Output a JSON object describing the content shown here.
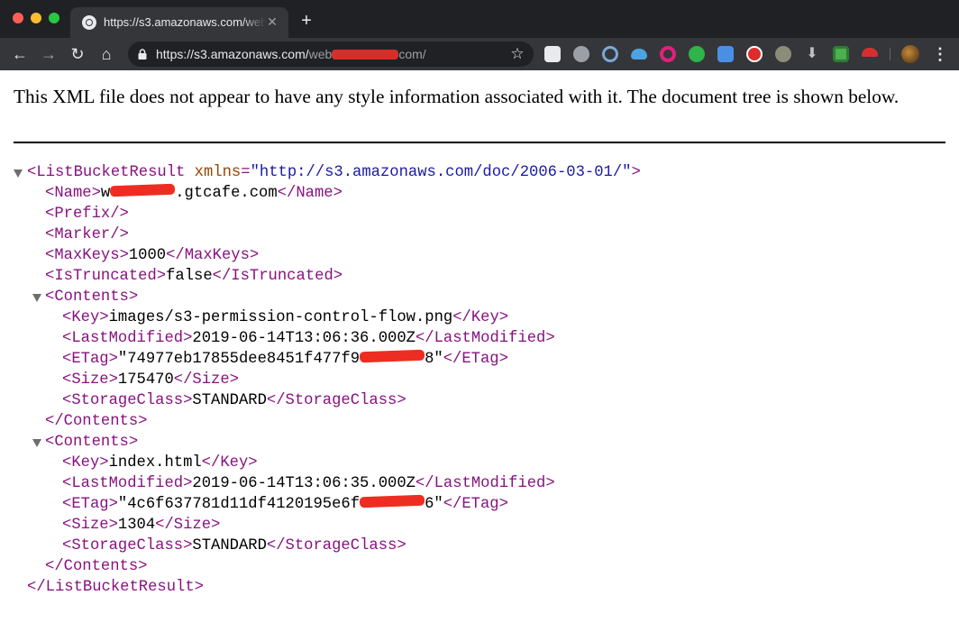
{
  "browser": {
    "tab_title": "https://s3.amazonaws.com/web",
    "tab_close": "✕",
    "new_tab": "+",
    "url_host": "https://s3.amazonaws.com/",
    "url_path_start": "web",
    "url_path_end": "com/",
    "nav_back": "←",
    "nav_forward": "→",
    "nav_reload": "↻",
    "nav_home": "⌂",
    "star": "☆",
    "menu": "⋮"
  },
  "page": {
    "notice": "This XML file does not appear to have any style information associated with it. The document tree is shown below."
  },
  "xml": {
    "root_open": "<ListBucketResult",
    "root_attr_name": "xmlns",
    "root_attr_eq": "=",
    "root_attr_value": "\"http://s3.amazonaws.com/doc/2006-03-01/\"",
    "root_open_end": ">",
    "root_close": "</ListBucketResult>",
    "name_open": "<Name>",
    "name_start": "w",
    "name_end": ".gtcafe.com",
    "name_close": "</Name>",
    "prefix": "<Prefix/>",
    "marker": "<Marker/>",
    "maxkeys_open": "<MaxKeys>",
    "maxkeys": "1000",
    "maxkeys_close": "</MaxKeys>",
    "truncated_open": "<IsTruncated>",
    "truncated": "false",
    "truncated_close": "</IsTruncated>",
    "contents_open": "<Contents>",
    "contents_close": "</Contents>",
    "key_open": "<Key>",
    "key_close": "</Key>",
    "lastmod_open": "<LastModified>",
    "lastmod_close": "</LastModified>",
    "etag_open": "<ETag>",
    "etag_close": "</ETag>",
    "size_open": "<Size>",
    "size_close": "</Size>",
    "storage_open": "<StorageClass>",
    "storage_close": "</StorageClass>",
    "contents": [
      {
        "key": "images/s3-permission-control-flow.png",
        "last_modified": "2019-06-14T13:06:36.000Z",
        "etag_start": "\"74977eb17855dee8451f477f9",
        "etag_end": "8\"",
        "size": "175470",
        "storage_class": "STANDARD"
      },
      {
        "key": "index.html",
        "last_modified": "2019-06-14T13:06:35.000Z",
        "etag_start": "\"4c6f637781d11df4120195e6f",
        "etag_end": "6\"",
        "size": "1304",
        "storage_class": "STANDARD"
      }
    ]
  },
  "colors": {
    "tag": "#881280",
    "attribute": "#994500",
    "attribute_value": "#1a1aa6",
    "redaction": "#ee2d22"
  },
  "icons": {
    "toolbar_extensions": [
      "extension-icon-1",
      "extension-icon-2",
      "extension-icon-3",
      "extension-icon-4",
      "extension-icon-5",
      "extension-icon-6",
      "extension-icon-7",
      "extension-icon-8",
      "extension-icon-9",
      "extension-icon-10",
      "extension-icon-11",
      "extension-icon-12"
    ]
  }
}
